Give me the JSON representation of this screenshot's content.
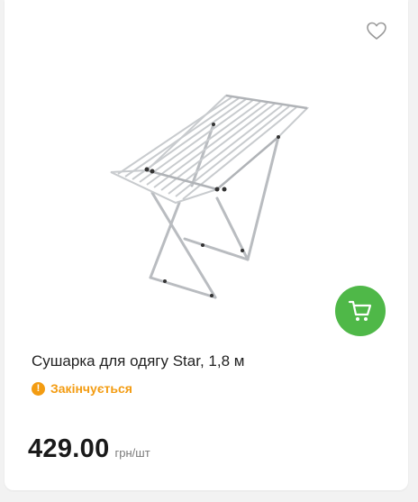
{
  "product": {
    "title": "Сушарка для одягу Star, 1,8 м",
    "status": "Закінчується",
    "price": "429.00",
    "price_unit": "грн/шт"
  },
  "icons": {
    "favorite": "heart-outline-icon",
    "cart": "cart-icon",
    "status": "exclamation-circle-icon"
  },
  "colors": {
    "accent_green": "#4fb848",
    "status_orange": "#f39c12"
  }
}
